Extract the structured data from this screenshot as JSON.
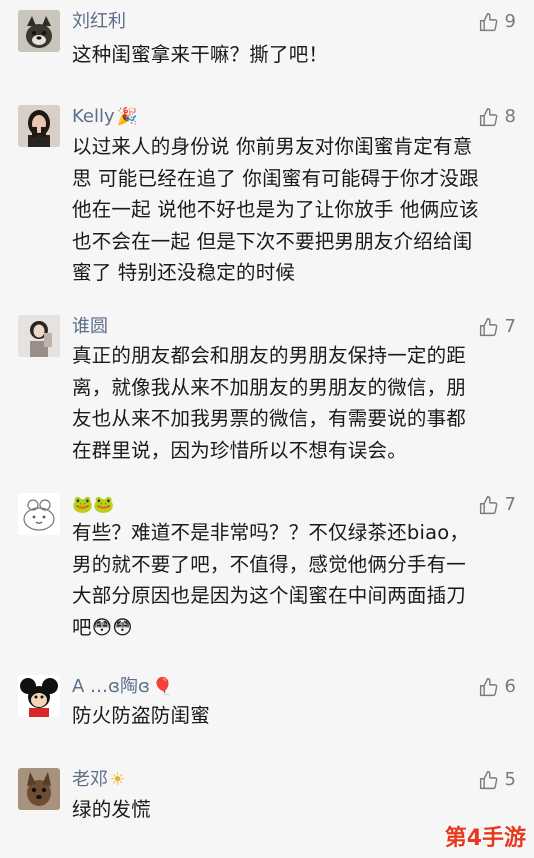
{
  "comments": [
    {
      "name": "刘红利",
      "name_emoji": "",
      "likes": "9",
      "text": "这种闺蜜拿来干嘛？撕了吧！",
      "avatar": "dog-avatar"
    },
    {
      "name": "Kelly",
      "name_emoji": "🎉",
      "likes": "8",
      "text": "以过来人的身份说 你前男友对你闺蜜肯定有意\n思 可能已经在追了 你闺蜜有可能碍于你才没跟\n他在一起 说他不好也是为了让你放手 他俩应该\n也不会在一起 但是下次不要把男朋友介绍给闺\n蜜了 特别还没稳定的时候",
      "avatar": "woman-avatar"
    },
    {
      "name": "谁圆",
      "name_emoji": "",
      "likes": "7",
      "text": "真正的朋友都会和朋友的男朋友保持一定的距\n离，就像我从来不加朋友的男朋友的微信，朋\n友也从来不加我男票的微信，有需要说的事都\n在群里说，因为珍惜所以不想有误会。",
      "avatar": "girl-avatar"
    },
    {
      "name": "",
      "name_emoji": "🐸🐸",
      "likes": "7",
      "text": "有些？难道不是非常吗？？不仅绿茶还biao，\n男的就不要了吧，不值得，感觉他俩分手有一\n大部分原因也是因为这个闺蜜在中间两面插刀\n吧",
      "text_trailing_emoji": "😳😳",
      "avatar": "cartoon-avatar"
    },
    {
      "name": "A …ɞ陶ɞ",
      "name_emoji": "🎈",
      "likes": "6",
      "text": "防火防盗防闺蜜",
      "avatar": "mouse-avatar"
    },
    {
      "name": "老邓",
      "name_emoji": "☀",
      "likes": "5",
      "text": "绿的发慌",
      "avatar": "dog2-avatar"
    }
  ],
  "watermark": "第4手游",
  "colors": {
    "background": "#f6f6f6",
    "name": "#5c6f8a",
    "text": "#1a1a1a",
    "like": "#7b7b7b",
    "watermark": "#e53a20"
  }
}
